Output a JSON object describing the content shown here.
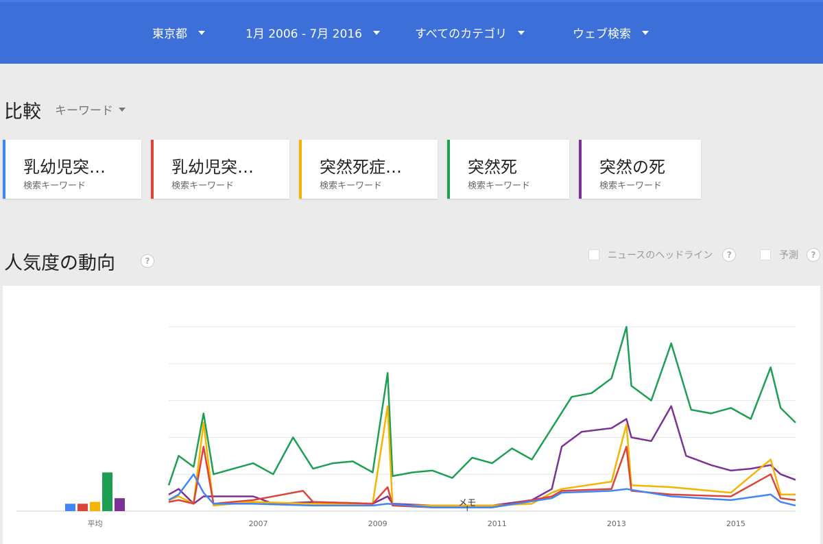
{
  "filters": {
    "region": "東京都",
    "period": "1月 2006 - 7月 2016",
    "category": "すべてのカテゴリ",
    "search_type": "ウェブ検索"
  },
  "compare": {
    "title": "比較",
    "type_label": "キーワード"
  },
  "cards": [
    {
      "term": "乳幼児突…",
      "sub": "検索キーワード",
      "color": "#4285f4"
    },
    {
      "term": "乳幼児突…",
      "sub": "検索キーワード",
      "color": "#db4437"
    },
    {
      "term": "突然死症…",
      "sub": "検索キーワード",
      "color": "#f4b400"
    },
    {
      "term": "突然死",
      "sub": "検索キーワード",
      "color": "#1e9e53"
    },
    {
      "term": "突然の死",
      "sub": "検索キーワード",
      "color": "#7b3294"
    }
  ],
  "trend": {
    "title": "人気度の動向",
    "help_glyph": "?",
    "news_label": "ニュースのヘッドライン",
    "forecast_label": "予測"
  },
  "chart_data": {
    "type": "line",
    "x_start": "2006-01",
    "x_end": "2016-07",
    "x_tick_labels": [
      "2007",
      "2009",
      "2011",
      "2013",
      "2015"
    ],
    "ylim": [
      0,
      100
    ],
    "grid": true,
    "annotation": "メモ",
    "average": {
      "label": "平均",
      "values": [
        4,
        4,
        5,
        21,
        7
      ],
      "colors": [
        "#4285f4",
        "#db4437",
        "#f4b400",
        "#1e9e53",
        "#7b3294"
      ]
    },
    "series": [
      {
        "color": "#1e9e53",
        "points": [
          [
            "2006-01",
            14
          ],
          [
            "2006-03",
            30
          ],
          [
            "2006-06",
            24
          ],
          [
            "2006-08",
            53
          ],
          [
            "2006-10",
            20
          ],
          [
            "2007-02",
            23
          ],
          [
            "2007-06",
            26
          ],
          [
            "2007-10",
            20
          ],
          [
            "2008-02",
            40
          ],
          [
            "2008-06",
            23
          ],
          [
            "2008-10",
            26
          ],
          [
            "2009-02",
            27
          ],
          [
            "2009-06",
            21
          ],
          [
            "2009-09",
            75
          ],
          [
            "2009-10",
            19
          ],
          [
            "2010-02",
            21
          ],
          [
            "2010-06",
            22
          ],
          [
            "2010-10",
            18
          ],
          [
            "2011-02",
            29
          ],
          [
            "2011-06",
            26
          ],
          [
            "2011-10",
            34
          ],
          [
            "2012-02",
            28
          ],
          [
            "2012-06",
            45
          ],
          [
            "2012-10",
            62
          ],
          [
            "2013-02",
            64
          ],
          [
            "2013-06",
            72
          ],
          [
            "2013-09",
            100
          ],
          [
            "2013-10",
            68
          ],
          [
            "2014-02",
            60
          ],
          [
            "2014-06",
            91
          ],
          [
            "2014-10",
            55
          ],
          [
            "2015-02",
            53
          ],
          [
            "2015-06",
            56
          ],
          [
            "2015-10",
            50
          ],
          [
            "2016-02",
            78
          ],
          [
            "2016-04",
            56
          ],
          [
            "2016-07",
            48
          ]
        ]
      },
      {
        "color": "#7b3294",
        "points": [
          [
            "2006-01",
            9
          ],
          [
            "2006-03",
            12
          ],
          [
            "2006-06",
            4
          ],
          [
            "2006-08",
            8
          ],
          [
            "2006-10",
            8
          ],
          [
            "2007-06",
            8
          ],
          [
            "2007-10",
            4
          ],
          [
            "2008-06",
            5
          ],
          [
            "2009-06",
            4
          ],
          [
            "2009-09",
            8
          ],
          [
            "2009-10",
            4
          ],
          [
            "2010-06",
            3
          ],
          [
            "2011-06",
            3
          ],
          [
            "2012-02",
            6
          ],
          [
            "2012-06",
            12
          ],
          [
            "2012-08",
            35
          ],
          [
            "2012-12",
            43
          ],
          [
            "2013-06",
            45
          ],
          [
            "2013-09",
            50
          ],
          [
            "2013-10",
            40
          ],
          [
            "2014-02",
            38
          ],
          [
            "2014-06",
            57
          ],
          [
            "2014-09",
            30
          ],
          [
            "2015-02",
            25
          ],
          [
            "2015-06",
            22
          ],
          [
            "2015-10",
            23
          ],
          [
            "2016-02",
            25
          ],
          [
            "2016-04",
            20
          ],
          [
            "2016-07",
            17
          ]
        ]
      },
      {
        "color": "#f4b400",
        "points": [
          [
            "2006-01",
            6
          ],
          [
            "2006-03",
            8
          ],
          [
            "2006-06",
            4
          ],
          [
            "2006-08",
            48
          ],
          [
            "2006-10",
            3
          ],
          [
            "2007-06",
            5
          ],
          [
            "2008-06",
            4
          ],
          [
            "2009-06",
            4
          ],
          [
            "2009-09",
            57
          ],
          [
            "2009-10",
            3
          ],
          [
            "2010-06",
            3
          ],
          [
            "2011-06",
            3
          ],
          [
            "2012-02",
            4
          ],
          [
            "2012-06",
            10
          ],
          [
            "2012-08",
            12
          ],
          [
            "2013-06",
            16
          ],
          [
            "2013-09",
            47
          ],
          [
            "2013-10",
            14
          ],
          [
            "2014-06",
            13
          ],
          [
            "2015-06",
            10
          ],
          [
            "2016-02",
            28
          ],
          [
            "2016-04",
            9
          ],
          [
            "2016-07",
            9
          ]
        ]
      },
      {
        "color": "#db4437",
        "points": [
          [
            "2006-01",
            5
          ],
          [
            "2006-03",
            6
          ],
          [
            "2006-06",
            4
          ],
          [
            "2006-08",
            35
          ],
          [
            "2006-10",
            4
          ],
          [
            "2007-06",
            6
          ],
          [
            "2008-04",
            11
          ],
          [
            "2008-06",
            5
          ],
          [
            "2009-06",
            4
          ],
          [
            "2009-09",
            13
          ],
          [
            "2009-10",
            3
          ],
          [
            "2010-06",
            2
          ],
          [
            "2011-06",
            2
          ],
          [
            "2012-06",
            8
          ],
          [
            "2012-08",
            11
          ],
          [
            "2013-06",
            12
          ],
          [
            "2013-09",
            35
          ],
          [
            "2013-10",
            11
          ],
          [
            "2014-06",
            9
          ],
          [
            "2015-06",
            8
          ],
          [
            "2016-02",
            20
          ],
          [
            "2016-04",
            7
          ],
          [
            "2016-07",
            6
          ]
        ]
      },
      {
        "color": "#4285f4",
        "points": [
          [
            "2006-01",
            6
          ],
          [
            "2006-03",
            9
          ],
          [
            "2006-06",
            20
          ],
          [
            "2006-08",
            10
          ],
          [
            "2006-10",
            4
          ],
          [
            "2007-06",
            4
          ],
          [
            "2008-06",
            3
          ],
          [
            "2009-06",
            3
          ],
          [
            "2009-09",
            4
          ],
          [
            "2010-06",
            2
          ],
          [
            "2011-06",
            2
          ],
          [
            "2012-06",
            7
          ],
          [
            "2012-08",
            10
          ],
          [
            "2013-06",
            11
          ],
          [
            "2013-09",
            12
          ],
          [
            "2014-06",
            8
          ],
          [
            "2015-06",
            6
          ],
          [
            "2016-02",
            9
          ],
          [
            "2016-04",
            5
          ],
          [
            "2016-07",
            3
          ]
        ]
      }
    ]
  }
}
